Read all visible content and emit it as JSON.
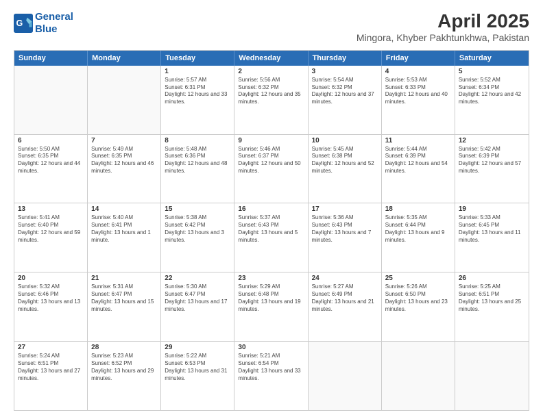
{
  "header": {
    "logo_line1": "General",
    "logo_line2": "Blue",
    "title": "April 2025",
    "subtitle": "Mingora, Khyber Pakhtunkhwa, Pakistan"
  },
  "calendar": {
    "days": [
      "Sunday",
      "Monday",
      "Tuesday",
      "Wednesday",
      "Thursday",
      "Friday",
      "Saturday"
    ],
    "rows": [
      [
        {
          "day": "",
          "empty": true
        },
        {
          "day": "",
          "empty": true
        },
        {
          "day": "1",
          "sunrise": "5:57 AM",
          "sunset": "6:31 PM",
          "daylight": "12 hours and 33 minutes."
        },
        {
          "day": "2",
          "sunrise": "5:56 AM",
          "sunset": "6:32 PM",
          "daylight": "12 hours and 35 minutes."
        },
        {
          "day": "3",
          "sunrise": "5:54 AM",
          "sunset": "6:32 PM",
          "daylight": "12 hours and 37 minutes."
        },
        {
          "day": "4",
          "sunrise": "5:53 AM",
          "sunset": "6:33 PM",
          "daylight": "12 hours and 40 minutes."
        },
        {
          "day": "5",
          "sunrise": "5:52 AM",
          "sunset": "6:34 PM",
          "daylight": "12 hours and 42 minutes."
        }
      ],
      [
        {
          "day": "6",
          "sunrise": "5:50 AM",
          "sunset": "6:35 PM",
          "daylight": "12 hours and 44 minutes."
        },
        {
          "day": "7",
          "sunrise": "5:49 AM",
          "sunset": "6:35 PM",
          "daylight": "12 hours and 46 minutes."
        },
        {
          "day": "8",
          "sunrise": "5:48 AM",
          "sunset": "6:36 PM",
          "daylight": "12 hours and 48 minutes."
        },
        {
          "day": "9",
          "sunrise": "5:46 AM",
          "sunset": "6:37 PM",
          "daylight": "12 hours and 50 minutes."
        },
        {
          "day": "10",
          "sunrise": "5:45 AM",
          "sunset": "6:38 PM",
          "daylight": "12 hours and 52 minutes."
        },
        {
          "day": "11",
          "sunrise": "5:44 AM",
          "sunset": "6:39 PM",
          "daylight": "12 hours and 54 minutes."
        },
        {
          "day": "12",
          "sunrise": "5:42 AM",
          "sunset": "6:39 PM",
          "daylight": "12 hours and 57 minutes."
        }
      ],
      [
        {
          "day": "13",
          "sunrise": "5:41 AM",
          "sunset": "6:40 PM",
          "daylight": "12 hours and 59 minutes."
        },
        {
          "day": "14",
          "sunrise": "5:40 AM",
          "sunset": "6:41 PM",
          "daylight": "13 hours and 1 minute."
        },
        {
          "day": "15",
          "sunrise": "5:38 AM",
          "sunset": "6:42 PM",
          "daylight": "13 hours and 3 minutes."
        },
        {
          "day": "16",
          "sunrise": "5:37 AM",
          "sunset": "6:43 PM",
          "daylight": "13 hours and 5 minutes."
        },
        {
          "day": "17",
          "sunrise": "5:36 AM",
          "sunset": "6:43 PM",
          "daylight": "13 hours and 7 minutes."
        },
        {
          "day": "18",
          "sunrise": "5:35 AM",
          "sunset": "6:44 PM",
          "daylight": "13 hours and 9 minutes."
        },
        {
          "day": "19",
          "sunrise": "5:33 AM",
          "sunset": "6:45 PM",
          "daylight": "13 hours and 11 minutes."
        }
      ],
      [
        {
          "day": "20",
          "sunrise": "5:32 AM",
          "sunset": "6:46 PM",
          "daylight": "13 hours and 13 minutes."
        },
        {
          "day": "21",
          "sunrise": "5:31 AM",
          "sunset": "6:47 PM",
          "daylight": "13 hours and 15 minutes."
        },
        {
          "day": "22",
          "sunrise": "5:30 AM",
          "sunset": "6:47 PM",
          "daylight": "13 hours and 17 minutes."
        },
        {
          "day": "23",
          "sunrise": "5:29 AM",
          "sunset": "6:48 PM",
          "daylight": "13 hours and 19 minutes."
        },
        {
          "day": "24",
          "sunrise": "5:27 AM",
          "sunset": "6:49 PM",
          "daylight": "13 hours and 21 minutes."
        },
        {
          "day": "25",
          "sunrise": "5:26 AM",
          "sunset": "6:50 PM",
          "daylight": "13 hours and 23 minutes."
        },
        {
          "day": "26",
          "sunrise": "5:25 AM",
          "sunset": "6:51 PM",
          "daylight": "13 hours and 25 minutes."
        }
      ],
      [
        {
          "day": "27",
          "sunrise": "5:24 AM",
          "sunset": "6:51 PM",
          "daylight": "13 hours and 27 minutes."
        },
        {
          "day": "28",
          "sunrise": "5:23 AM",
          "sunset": "6:52 PM",
          "daylight": "13 hours and 29 minutes."
        },
        {
          "day": "29",
          "sunrise": "5:22 AM",
          "sunset": "6:53 PM",
          "daylight": "13 hours and 31 minutes."
        },
        {
          "day": "30",
          "sunrise": "5:21 AM",
          "sunset": "6:54 PM",
          "daylight": "13 hours and 33 minutes."
        },
        {
          "day": "",
          "empty": true
        },
        {
          "day": "",
          "empty": true
        },
        {
          "day": "",
          "empty": true
        }
      ]
    ]
  }
}
